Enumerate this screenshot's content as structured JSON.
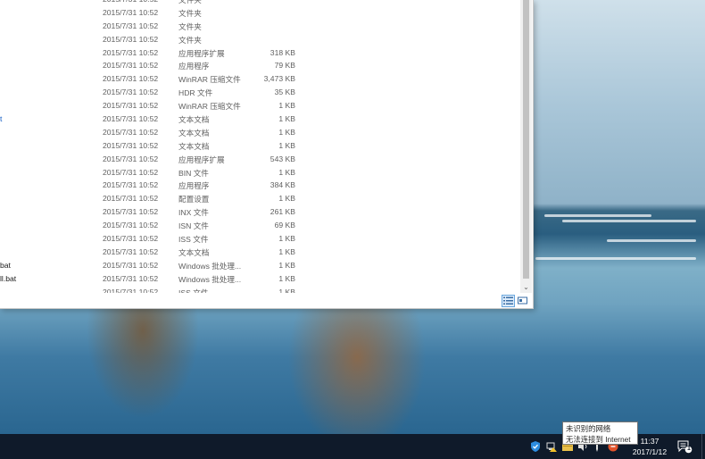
{
  "explorer": {
    "files": [
      {
        "name": "",
        "date": "2015/7/31 10:52",
        "type": "文件夹",
        "size": ""
      },
      {
        "name": "",
        "date": "2015/7/31 10:52",
        "type": "文件夹",
        "size": ""
      },
      {
        "name": "",
        "date": "2015/7/31 10:52",
        "type": "文件夹",
        "size": ""
      },
      {
        "name": "",
        "date": "2015/7/31 10:52",
        "type": "文件夹",
        "size": ""
      },
      {
        "name": "",
        "date": "2015/7/31 10:52",
        "type": "应用程序扩展",
        "size": "318 KB"
      },
      {
        "name": "",
        "date": "2015/7/31 10:52",
        "type": "应用程序",
        "size": "79 KB"
      },
      {
        "name": "",
        "date": "2015/7/31 10:52",
        "type": "WinRAR 压缩文件",
        "size": "3,473 KB"
      },
      {
        "name": "",
        "date": "2015/7/31 10:52",
        "type": "HDR 文件",
        "size": "35 KB"
      },
      {
        "name": "",
        "date": "2015/7/31 10:52",
        "type": "WinRAR 压缩文件",
        "size": "1 KB"
      },
      {
        "name": "t",
        "date": "2015/7/31 10:52",
        "type": "文本文档",
        "size": "1 KB"
      },
      {
        "name": "",
        "date": "2015/7/31 10:52",
        "type": "文本文档",
        "size": "1 KB"
      },
      {
        "name": "",
        "date": "2015/7/31 10:52",
        "type": "文本文档",
        "size": "1 KB"
      },
      {
        "name": "",
        "date": "2015/7/31 10:52",
        "type": "应用程序扩展",
        "size": "543 KB"
      },
      {
        "name": "",
        "date": "2015/7/31 10:52",
        "type": "BIN 文件",
        "size": "1 KB"
      },
      {
        "name": "",
        "date": "2015/7/31 10:52",
        "type": "应用程序",
        "size": "384 KB"
      },
      {
        "name": "",
        "date": "2015/7/31 10:52",
        "type": "配置设置",
        "size": "1 KB"
      },
      {
        "name": "",
        "date": "2015/7/31 10:52",
        "type": "INX 文件",
        "size": "261 KB"
      },
      {
        "name": "",
        "date": "2015/7/31 10:52",
        "type": "ISN 文件",
        "size": "69 KB"
      },
      {
        "name": "",
        "date": "2015/7/31 10:52",
        "type": "ISS 文件",
        "size": "1 KB"
      },
      {
        "name": "",
        "date": "2015/7/31 10:52",
        "type": "文本文档",
        "size": "1 KB"
      },
      {
        "name": "bat",
        "date": "2015/7/31 10:52",
        "type": "Windows 批处理...",
        "size": "1 KB"
      },
      {
        "name": "ll.bat",
        "date": "2015/7/31 10:52",
        "type": "Windows 批处理...",
        "size": "1 KB"
      },
      {
        "name": "",
        "date": "2015/7/31 10:52",
        "type": "ISS 文件",
        "size": "1 KB"
      }
    ],
    "scroll_down_glyph": "⌄",
    "view_icons": {
      "details": "details-view-icon",
      "large": "large-icons-view-icon"
    }
  },
  "tooltip": {
    "line1": "未识别的网络",
    "line2": "无法连接到 Internet"
  },
  "taskbar": {
    "time": "11:37",
    "date": "2017/1/12",
    "notification_count": "1",
    "tray_icons": [
      "shield-icon",
      "network-icon",
      "folder-icon",
      "volume-icon",
      "pen-icon",
      "app-icon"
    ]
  },
  "colors": {
    "taskbar_bg": "#0f1a2a",
    "link_blue": "#0b57c2",
    "selection_blue": "#6aa7de"
  }
}
